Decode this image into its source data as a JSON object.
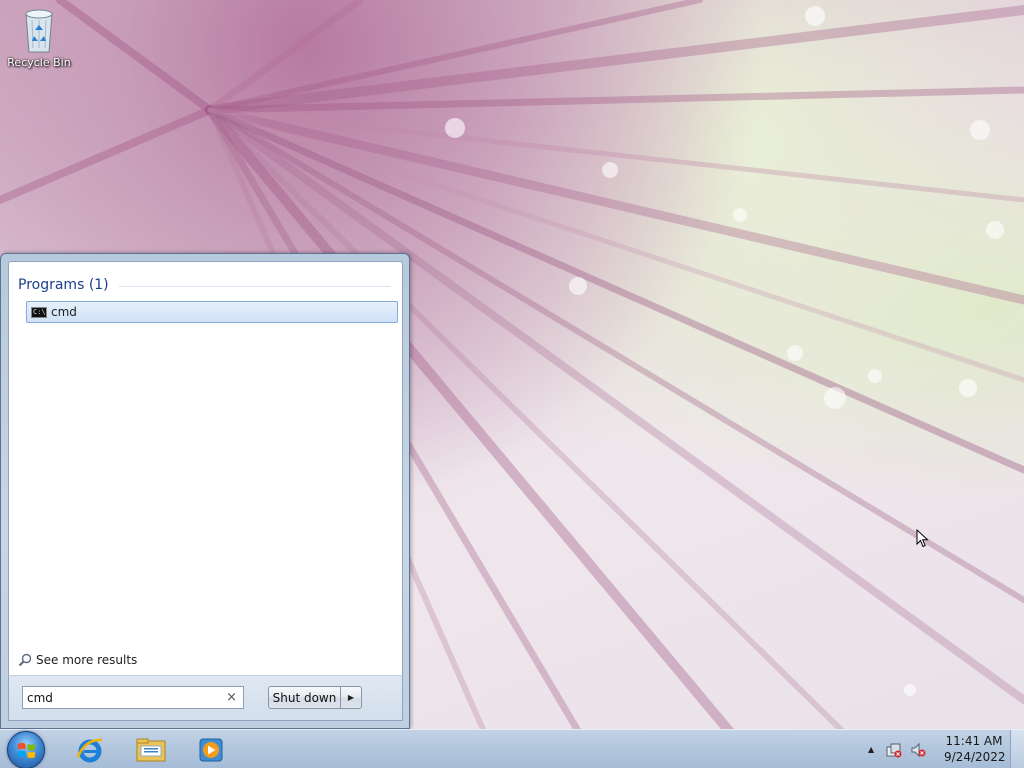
{
  "desktop": {
    "recycle_bin_label": "Recycle Bin"
  },
  "start_menu": {
    "section_title": "Programs (1)",
    "results": [
      {
        "label": "cmd",
        "icon": "command-prompt-icon"
      }
    ],
    "see_more_label": "See more results",
    "search": {
      "value": "cmd",
      "clear_glyph": "×"
    },
    "shutdown_label": "Shut down",
    "shutdown_arrow_glyph": "▶"
  },
  "taskbar": {
    "pinned": [
      {
        "name": "internet-explorer-icon"
      },
      {
        "name": "windows-explorer-icon"
      },
      {
        "name": "media-player-icon"
      }
    ],
    "tray": {
      "show_hidden_glyph": "▲",
      "icons": [
        "action-center-icon",
        "volume-muted-icon"
      ]
    },
    "clock": {
      "time": "11:41 AM",
      "date": "9/24/2022"
    }
  },
  "colors": {
    "accent": "#1e3f8c",
    "selection_border": "#84acdd",
    "taskbar": "#b3c7de"
  }
}
